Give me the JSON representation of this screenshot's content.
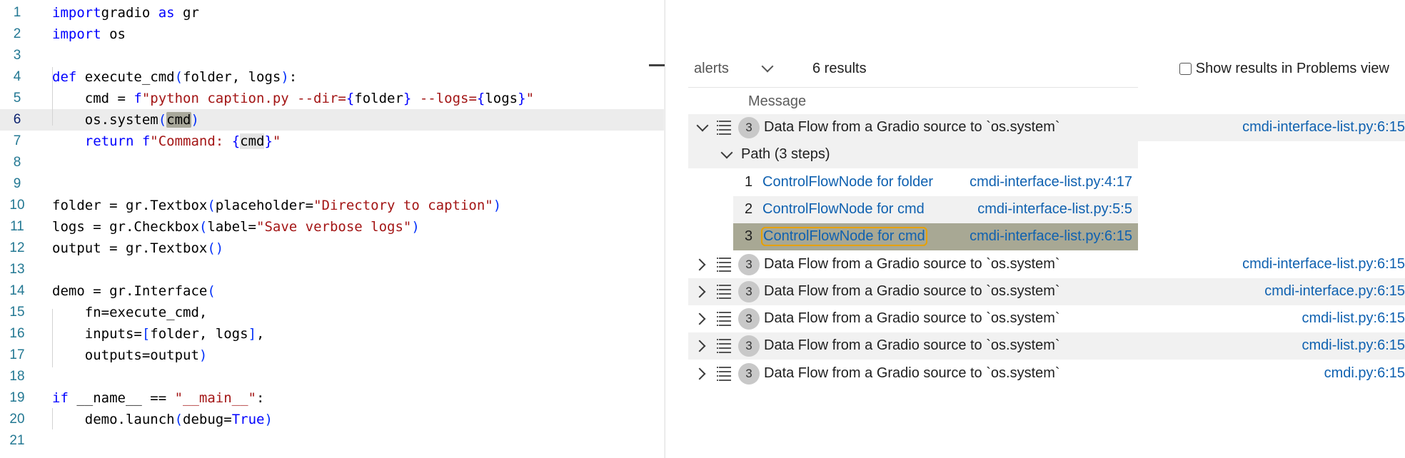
{
  "editor": {
    "lines": [
      {
        "n": "1",
        "html_parts": [
          [
            "kw",
            "import"
          ],
          [
            "",
            "gradio "
          ],
          [
            "kw",
            "as"
          ],
          [
            "",
            " gr"
          ]
        ]
      },
      {
        "n": "2",
        "html_parts": [
          [
            "kw",
            "import"
          ],
          [
            "",
            " os"
          ]
        ]
      },
      {
        "n": "3",
        "html_parts": []
      },
      {
        "n": "4",
        "html_parts": [
          [
            "kw",
            "def"
          ],
          [
            "",
            " execute_cmd"
          ],
          [
            "brk",
            "("
          ],
          [
            "",
            "folder, logs"
          ],
          [
            "brk",
            ")"
          ],
          [
            "",
            ":"
          ]
        ]
      },
      {
        "n": "5",
        "html_parts": [
          [
            "",
            "    cmd = "
          ],
          [
            "kw",
            "f"
          ],
          [
            "str",
            "\"python caption.py --dir="
          ],
          [
            "kw",
            "{"
          ],
          [
            "",
            "folder"
          ],
          [
            "kw",
            "}"
          ],
          [
            "str",
            " --logs="
          ],
          [
            "kw",
            "{"
          ],
          [
            "",
            "logs"
          ],
          [
            "kw",
            "}"
          ],
          [
            "str",
            "\""
          ]
        ]
      },
      {
        "n": "6",
        "html_parts": [
          [
            "",
            "    os.system"
          ],
          [
            "brk",
            "("
          ],
          [
            "hl",
            "cmd"
          ],
          [
            "brk",
            ")"
          ]
        ]
      },
      {
        "n": "7",
        "html_parts": [
          [
            "kw",
            "    return "
          ],
          [
            "kw",
            "f"
          ],
          [
            "str",
            "\"Command: "
          ],
          [
            "kw",
            "{"
          ],
          [
            "hlw",
            "cmd"
          ],
          [
            "kw",
            "}"
          ],
          [
            "str",
            "\""
          ]
        ]
      },
      {
        "n": "8",
        "html_parts": []
      },
      {
        "n": "9",
        "html_parts": []
      },
      {
        "n": "10",
        "html_parts": [
          [
            "",
            "folder = gr.Textbox"
          ],
          [
            "brk",
            "("
          ],
          [
            "",
            "placeholder="
          ],
          [
            "str",
            "\"Directory to caption\""
          ],
          [
            "brk",
            ")"
          ]
        ]
      },
      {
        "n": "11",
        "html_parts": [
          [
            "",
            "logs = gr.Checkbox"
          ],
          [
            "brk",
            "("
          ],
          [
            "",
            "label="
          ],
          [
            "str",
            "\"Save verbose logs\""
          ],
          [
            "brk",
            ")"
          ]
        ]
      },
      {
        "n": "12",
        "html_parts": [
          [
            "",
            "output = gr.Textbox"
          ],
          [
            "brk",
            "()"
          ]
        ]
      },
      {
        "n": "13",
        "html_parts": []
      },
      {
        "n": "14",
        "html_parts": [
          [
            "",
            "demo = gr.Interface"
          ],
          [
            "brk",
            "("
          ]
        ]
      },
      {
        "n": "15",
        "html_parts": [
          [
            "",
            "    fn=execute_cmd,"
          ]
        ]
      },
      {
        "n": "16",
        "html_parts": [
          [
            "",
            "    inputs="
          ],
          [
            "brk",
            "["
          ],
          [
            "",
            "folder, logs"
          ],
          [
            "brk",
            "]"
          ],
          [
            "",
            ","
          ]
        ]
      },
      {
        "n": "17",
        "html_parts": [
          [
            "",
            "    outputs=output"
          ],
          [
            "brk",
            ")"
          ]
        ]
      },
      {
        "n": "18",
        "html_parts": []
      },
      {
        "n": "19",
        "html_parts": [
          [
            "kw",
            "if"
          ],
          [
            "",
            " __name__ == "
          ],
          [
            "str",
            "\"__main__\""
          ],
          [
            "",
            ":"
          ]
        ]
      },
      {
        "n": "20",
        "html_parts": [
          [
            "",
            "    demo.launch"
          ],
          [
            "brk",
            "("
          ],
          [
            "",
            "debug="
          ],
          [
            "kw",
            "True"
          ],
          [
            "brk",
            ")"
          ]
        ]
      },
      {
        "n": "21",
        "html_parts": []
      }
    ]
  },
  "results": {
    "query_select": "alerts",
    "count_label": "6 results",
    "problems_toggle_label": "Show results in Problems view",
    "column_header": "Message",
    "alerts": [
      {
        "badge": "3",
        "message": "Data Flow from a Gradio source to `os.system`",
        "location": "cmdi-interface-list.py:6:15",
        "expanded": true
      },
      {
        "badge": "3",
        "message": "Data Flow from a Gradio source to `os.system`",
        "location": "cmdi-interface-list.py:6:15",
        "expanded": false
      },
      {
        "badge": "3",
        "message": "Data Flow from a Gradio source to `os.system`",
        "location": "cmdi-interface.py:6:15",
        "expanded": false
      },
      {
        "badge": "3",
        "message": "Data Flow from a Gradio source to `os.system`",
        "location": "cmdi-list.py:6:15",
        "expanded": false
      },
      {
        "badge": "3",
        "message": "Data Flow from a Gradio source to `os.system`",
        "location": "cmdi-list.py:6:15",
        "expanded": false
      },
      {
        "badge": "3",
        "message": "Data Flow from a Gradio source to `os.system`",
        "location": "cmdi.py:6:15",
        "expanded": false
      }
    ],
    "path": {
      "label": "Path (3 steps)",
      "steps": [
        {
          "n": "1",
          "node": "ControlFlowNode for folder",
          "location": "cmdi-interface-list.py:4:17"
        },
        {
          "n": "2",
          "node": "ControlFlowNode for cmd",
          "location": "cmdi-interface-list.py:5:5"
        },
        {
          "n": "3",
          "node": "ControlFlowNode for cmd",
          "location": "cmdi-interface-list.py:6:15"
        }
      ]
    }
  }
}
